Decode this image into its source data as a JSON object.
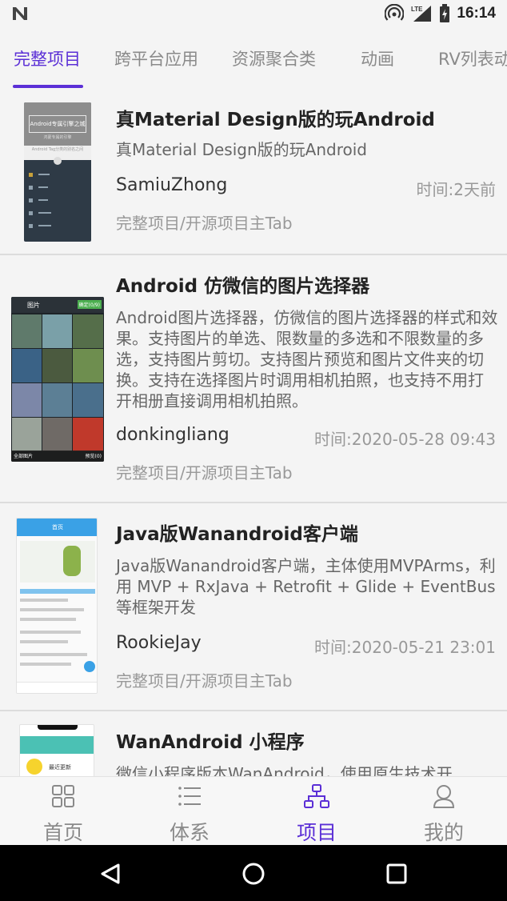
{
  "status_bar": {
    "time": "16:14",
    "network": "LTE"
  },
  "tabs": [
    {
      "label": "完整项目",
      "active": true
    },
    {
      "label": "跨平台应用",
      "active": false
    },
    {
      "label": "资源聚合类",
      "active": false
    },
    {
      "label": "动画",
      "active": false
    },
    {
      "label": "RV列表动",
      "active": false
    }
  ],
  "projects": [
    {
      "title": "真Material Design版的玩Android",
      "desc": "真Material Design版的玩Android",
      "author": "SamiuZhong",
      "time": "时间:2天前",
      "chapter": "完整项目/开源项目主Tab",
      "thumb": {
        "banner_title": "Android专属引擎之城",
        "banner_sub": "鸿蒙专属的引擎",
        "caption": "Android Tag分类的别名之间"
      }
    },
    {
      "title": "Android 仿微信的图片选择器",
      "desc": "Android图片选择器，仿微信的图片选择器的样式和效果。支持图片的单选、限数量的多选和不限数量的多选，支持图片剪切。支持图片预览和图片文件夹的切换。支持在选择图片时调用相机拍照，也支持不用打开相册直接调用相机拍照。",
      "author": "donkingliang",
      "time": "时间:2020-05-28 09:43",
      "chapter": "完整项目/开源项目主Tab",
      "thumb": {
        "top_title": "图片",
        "top_btn": "确定(0/9)",
        "bottom_left": "全部图片",
        "bottom_right": "预览(0)"
      }
    },
    {
      "title": "Java版Wanandroid客户端",
      "desc": "Java版Wanandroid客户端，主体使用MVPArms，利用 MVP + RxJava + Retrofit + Glide + EventBus等框架开发",
      "author": "RookieJay",
      "time": "时间:2020-05-21 23:01",
      "chapter": "完整项目/开源项目主Tab",
      "thumb": {
        "header": "首页"
      }
    },
    {
      "title": "WanAndroid 小程序",
      "desc": "微信小程序版本WanAndroid，使用原生技术开",
      "author": "",
      "time": "",
      "chapter": "",
      "thumb": {
        "label": "最近更新"
      }
    }
  ],
  "bottom_nav": [
    {
      "label": "首页",
      "icon": "grid-icon",
      "active": false
    },
    {
      "label": "体系",
      "icon": "list-icon",
      "active": false
    },
    {
      "label": "项目",
      "icon": "tree-icon",
      "active": true
    },
    {
      "label": "我的",
      "icon": "person-icon",
      "active": false
    }
  ],
  "colors": {
    "accent": "#5b2fd6",
    "inactive": "#8a8a8a",
    "background": "#f4f4f4"
  }
}
